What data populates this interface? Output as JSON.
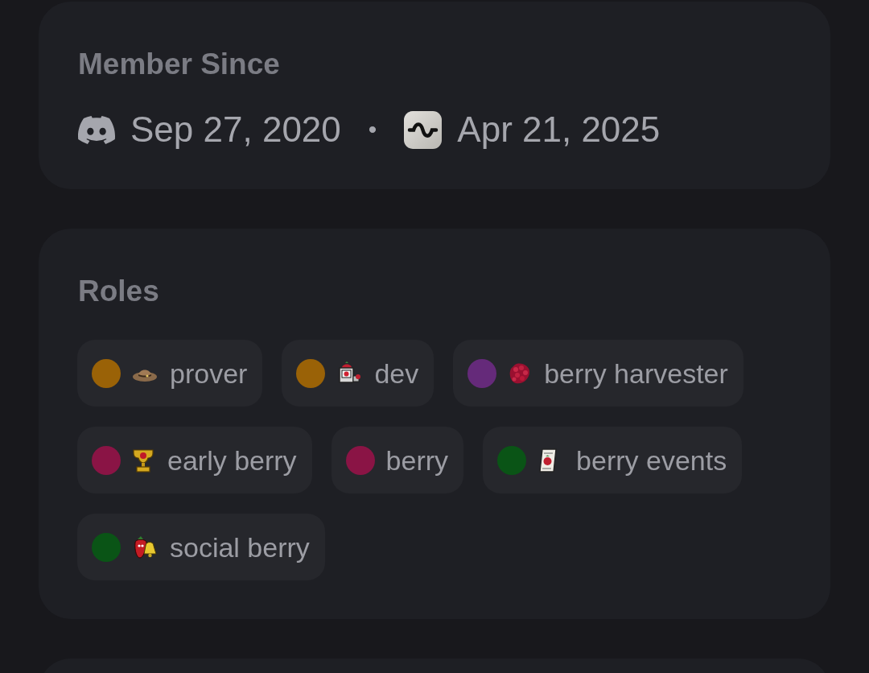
{
  "member_since": {
    "title": "Member Since",
    "entries": [
      {
        "kind": "platform",
        "date": "Sep 27, 2020"
      },
      {
        "kind": "server",
        "date": "Apr 21, 2025"
      }
    ],
    "separator": "•"
  },
  "roles": {
    "title": "Roles",
    "items": [
      {
        "name": "prover",
        "color": "#9a6207",
        "kind": "hat"
      },
      {
        "name": "dev",
        "color": "#9a6207",
        "kind": "machine"
      },
      {
        "name": "berry harvester",
        "color": "#652a7a",
        "kind": "raspberry"
      },
      {
        "name": "early berry",
        "color": "#8a1445",
        "kind": "trophy"
      },
      {
        "name": "berry",
        "color": "#8a1445",
        "kind": "plain"
      },
      {
        "name": "berry events",
        "color": "#0a5416",
        "kind": "scroll"
      },
      {
        "name": "social berry",
        "color": "#0a5416",
        "kind": "bell"
      }
    ]
  }
}
